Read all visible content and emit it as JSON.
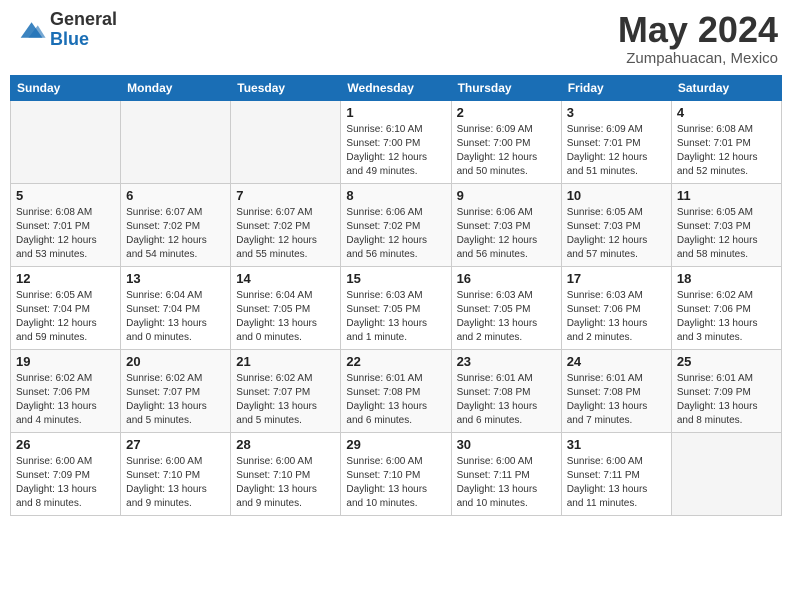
{
  "header": {
    "logo_general": "General",
    "logo_blue": "Blue",
    "month_title": "May 2024",
    "location": "Zumpahuacan, Mexico"
  },
  "weekdays": [
    "Sunday",
    "Monday",
    "Tuesday",
    "Wednesday",
    "Thursday",
    "Friday",
    "Saturday"
  ],
  "weeks": [
    [
      {
        "day": "",
        "info": ""
      },
      {
        "day": "",
        "info": ""
      },
      {
        "day": "",
        "info": ""
      },
      {
        "day": "1",
        "info": "Sunrise: 6:10 AM\nSunset: 7:00 PM\nDaylight: 12 hours\nand 49 minutes."
      },
      {
        "day": "2",
        "info": "Sunrise: 6:09 AM\nSunset: 7:00 PM\nDaylight: 12 hours\nand 50 minutes."
      },
      {
        "day": "3",
        "info": "Sunrise: 6:09 AM\nSunset: 7:01 PM\nDaylight: 12 hours\nand 51 minutes."
      },
      {
        "day": "4",
        "info": "Sunrise: 6:08 AM\nSunset: 7:01 PM\nDaylight: 12 hours\nand 52 minutes."
      }
    ],
    [
      {
        "day": "5",
        "info": "Sunrise: 6:08 AM\nSunset: 7:01 PM\nDaylight: 12 hours\nand 53 minutes."
      },
      {
        "day": "6",
        "info": "Sunrise: 6:07 AM\nSunset: 7:02 PM\nDaylight: 12 hours\nand 54 minutes."
      },
      {
        "day": "7",
        "info": "Sunrise: 6:07 AM\nSunset: 7:02 PM\nDaylight: 12 hours\nand 55 minutes."
      },
      {
        "day": "8",
        "info": "Sunrise: 6:06 AM\nSunset: 7:02 PM\nDaylight: 12 hours\nand 56 minutes."
      },
      {
        "day": "9",
        "info": "Sunrise: 6:06 AM\nSunset: 7:03 PM\nDaylight: 12 hours\nand 56 minutes."
      },
      {
        "day": "10",
        "info": "Sunrise: 6:05 AM\nSunset: 7:03 PM\nDaylight: 12 hours\nand 57 minutes."
      },
      {
        "day": "11",
        "info": "Sunrise: 6:05 AM\nSunset: 7:03 PM\nDaylight: 12 hours\nand 58 minutes."
      }
    ],
    [
      {
        "day": "12",
        "info": "Sunrise: 6:05 AM\nSunset: 7:04 PM\nDaylight: 12 hours\nand 59 minutes."
      },
      {
        "day": "13",
        "info": "Sunrise: 6:04 AM\nSunset: 7:04 PM\nDaylight: 13 hours\nand 0 minutes."
      },
      {
        "day": "14",
        "info": "Sunrise: 6:04 AM\nSunset: 7:05 PM\nDaylight: 13 hours\nand 0 minutes."
      },
      {
        "day": "15",
        "info": "Sunrise: 6:03 AM\nSunset: 7:05 PM\nDaylight: 13 hours\nand 1 minute."
      },
      {
        "day": "16",
        "info": "Sunrise: 6:03 AM\nSunset: 7:05 PM\nDaylight: 13 hours\nand 2 minutes."
      },
      {
        "day": "17",
        "info": "Sunrise: 6:03 AM\nSunset: 7:06 PM\nDaylight: 13 hours\nand 2 minutes."
      },
      {
        "day": "18",
        "info": "Sunrise: 6:02 AM\nSunset: 7:06 PM\nDaylight: 13 hours\nand 3 minutes."
      }
    ],
    [
      {
        "day": "19",
        "info": "Sunrise: 6:02 AM\nSunset: 7:06 PM\nDaylight: 13 hours\nand 4 minutes."
      },
      {
        "day": "20",
        "info": "Sunrise: 6:02 AM\nSunset: 7:07 PM\nDaylight: 13 hours\nand 5 minutes."
      },
      {
        "day": "21",
        "info": "Sunrise: 6:02 AM\nSunset: 7:07 PM\nDaylight: 13 hours\nand 5 minutes."
      },
      {
        "day": "22",
        "info": "Sunrise: 6:01 AM\nSunset: 7:08 PM\nDaylight: 13 hours\nand 6 minutes."
      },
      {
        "day": "23",
        "info": "Sunrise: 6:01 AM\nSunset: 7:08 PM\nDaylight: 13 hours\nand 6 minutes."
      },
      {
        "day": "24",
        "info": "Sunrise: 6:01 AM\nSunset: 7:08 PM\nDaylight: 13 hours\nand 7 minutes."
      },
      {
        "day": "25",
        "info": "Sunrise: 6:01 AM\nSunset: 7:09 PM\nDaylight: 13 hours\nand 8 minutes."
      }
    ],
    [
      {
        "day": "26",
        "info": "Sunrise: 6:00 AM\nSunset: 7:09 PM\nDaylight: 13 hours\nand 8 minutes."
      },
      {
        "day": "27",
        "info": "Sunrise: 6:00 AM\nSunset: 7:10 PM\nDaylight: 13 hours\nand 9 minutes."
      },
      {
        "day": "28",
        "info": "Sunrise: 6:00 AM\nSunset: 7:10 PM\nDaylight: 13 hours\nand 9 minutes."
      },
      {
        "day": "29",
        "info": "Sunrise: 6:00 AM\nSunset: 7:10 PM\nDaylight: 13 hours\nand 10 minutes."
      },
      {
        "day": "30",
        "info": "Sunrise: 6:00 AM\nSunset: 7:11 PM\nDaylight: 13 hours\nand 10 minutes."
      },
      {
        "day": "31",
        "info": "Sunrise: 6:00 AM\nSunset: 7:11 PM\nDaylight: 13 hours\nand 11 minutes."
      },
      {
        "day": "",
        "info": ""
      }
    ]
  ]
}
